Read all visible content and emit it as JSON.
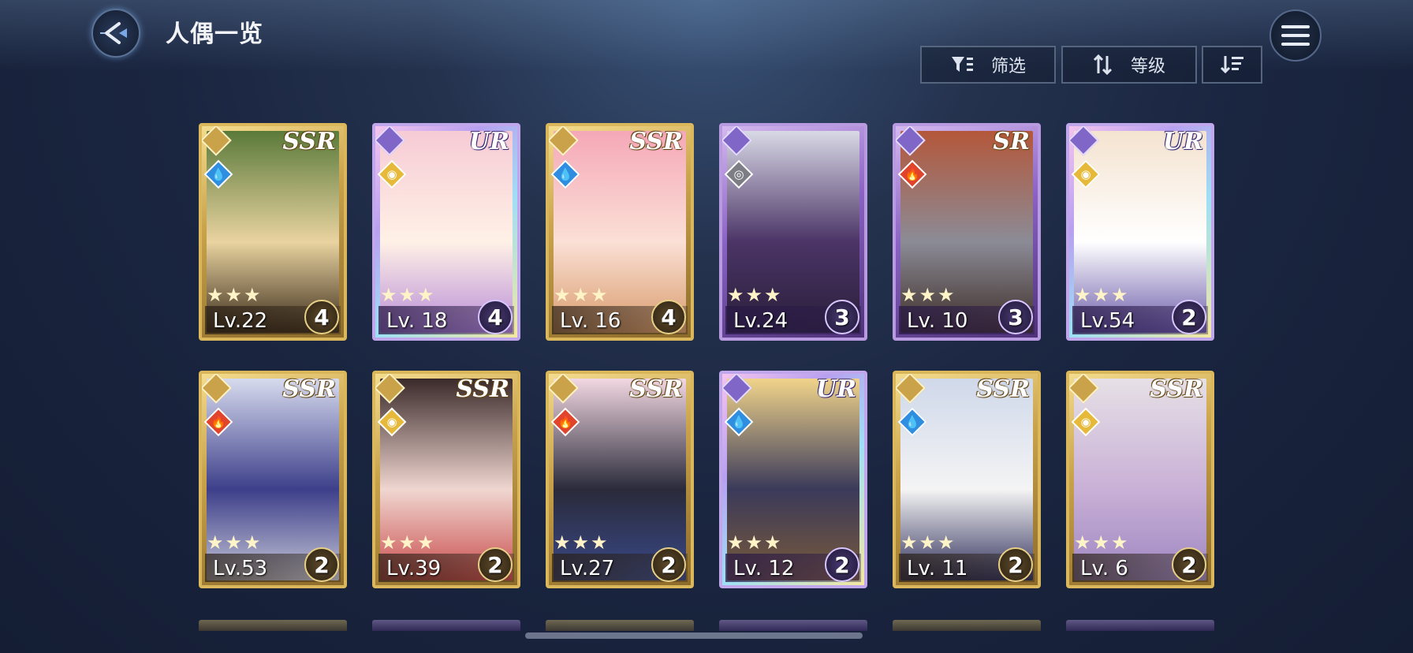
{
  "header": {
    "title": "人偶一览"
  },
  "toolbar": {
    "filter_label": "筛选",
    "sort_label": "等级"
  },
  "cards": [
    {
      "rarity": "SSR",
      "level": "Lv.22",
      "count": "4",
      "stars": "★★★",
      "element": "water",
      "frame": "gold"
    },
    {
      "rarity": "UR",
      "level": "Lv. 18",
      "count": "4",
      "stars": "★★★",
      "element": "light",
      "frame": "rainbow"
    },
    {
      "rarity": "SSR",
      "level": "Lv. 16",
      "count": "4",
      "stars": "★★★",
      "element": "water",
      "frame": "gold"
    },
    {
      "rarity": "",
      "level": "Lv.24",
      "count": "3",
      "stars": "★★★",
      "element": "dark",
      "frame": "purple"
    },
    {
      "rarity": "SR",
      "level": "Lv. 10",
      "count": "3",
      "stars": "★★★",
      "element": "fire",
      "frame": "purple"
    },
    {
      "rarity": "UR",
      "level": "Lv.54",
      "count": "2",
      "stars": "★★★",
      "element": "light",
      "frame": "rainbow"
    },
    {
      "rarity": "SSR",
      "level": "Lv.53",
      "count": "2",
      "stars": "★★★",
      "element": "fire",
      "frame": "gold"
    },
    {
      "rarity": "SSR",
      "level": "Lv.39",
      "count": "2",
      "stars": "★★★",
      "element": "light",
      "frame": "gold"
    },
    {
      "rarity": "SSR",
      "level": "Lv.27",
      "count": "2",
      "stars": "★★★",
      "element": "fire",
      "frame": "gold"
    },
    {
      "rarity": "UR",
      "level": "Lv. 12",
      "count": "2",
      "stars": "★★★",
      "element": "water",
      "frame": "rainbow"
    },
    {
      "rarity": "SSR",
      "level": "Lv. 11",
      "count": "2",
      "stars": "★★★",
      "element": "water",
      "frame": "gold"
    },
    {
      "rarity": "SSR",
      "level": "Lv. 6",
      "count": "2",
      "stars": "★★★",
      "element": "light",
      "frame": "gold"
    }
  ],
  "colors": {
    "gold_frame": "#d9b75a",
    "purple_frame": "#b79adf",
    "background": "#1a2540",
    "water": "#2f8ee0",
    "fire": "#e0452c",
    "light": "#e6b93a",
    "dark": "#7d7d86"
  }
}
